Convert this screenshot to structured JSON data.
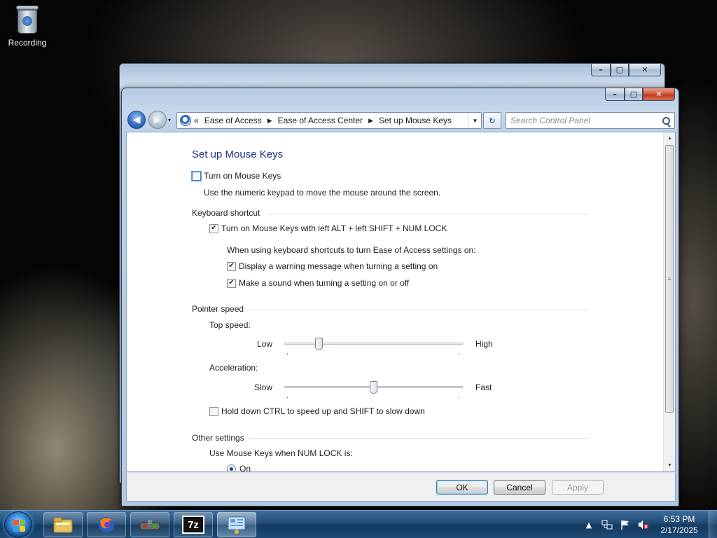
{
  "desktop": {
    "icons": [
      {
        "label": "Recording",
        "icon": "recycle-bin-icon"
      }
    ]
  },
  "window": {
    "caption_buttons": {
      "minimize": "–",
      "maximize": "□",
      "close": "✕"
    },
    "nav": {
      "back": "◀",
      "forward": "▶",
      "recent": "▾"
    },
    "breadcrumb": {
      "overflow": "«",
      "items": [
        "Ease of Access",
        "Ease of Access Center",
        "Set up Mouse Keys"
      ],
      "separator": "▶",
      "dropdown": "▼"
    },
    "refresh": "↻",
    "search": {
      "placeholder": "Search Control Panel",
      "value": ""
    }
  },
  "page": {
    "title": "Set up Mouse Keys",
    "turn_on": {
      "label": "Turn on Mouse Keys",
      "checked": false
    },
    "turn_on_desc": "Use the numeric keypad to move the mouse around the screen.",
    "keyboard_shortcut": {
      "heading": "Keyboard shortcut",
      "shortcut": {
        "label": "Turn on Mouse Keys with left ALT + left SHIFT + NUM LOCK",
        "checked": true
      },
      "intro": "When using keyboard shortcuts to turn Ease of Access settings on:",
      "warning": {
        "label": "Display a warning message when turning a setting on",
        "checked": true
      },
      "sound": {
        "label": "Make a sound when turning a setting on or off",
        "checked": true
      }
    },
    "pointer_speed": {
      "heading": "Pointer speed",
      "top_speed": {
        "label": "Top speed:",
        "min_label": "Low",
        "max_label": "High",
        "value_fraction": 0.18
      },
      "acceleration": {
        "label": "Acceleration:",
        "min_label": "Slow",
        "max_label": "Fast",
        "value_fraction": 0.5
      },
      "ctrl_shift": {
        "label": "Hold down CTRL to speed up and SHIFT to slow down",
        "checked": false
      }
    },
    "other_settings": {
      "heading": "Other settings",
      "numlock_label": "Use Mouse Keys when NUM LOCK is:",
      "numlock_on": {
        "label": "On",
        "selected": true
      }
    }
  },
  "buttons": {
    "ok": "OK",
    "cancel": "Cancel",
    "apply": "Apply"
  },
  "taskbar": {
    "items": [
      {
        "name": "windows-explorer",
        "icon": "folder-icon"
      },
      {
        "name": "firefox",
        "icon": "firefox-icon"
      },
      {
        "name": "recorder-app",
        "icon": "app-icon"
      },
      {
        "name": "7zip",
        "icon": "7zip-icon",
        "label": "7z"
      },
      {
        "name": "control-panel",
        "icon": "control-panel-icon",
        "active": true
      }
    ],
    "clock": {
      "time": "6:53 PM",
      "date": "2/17/2025"
    }
  }
}
